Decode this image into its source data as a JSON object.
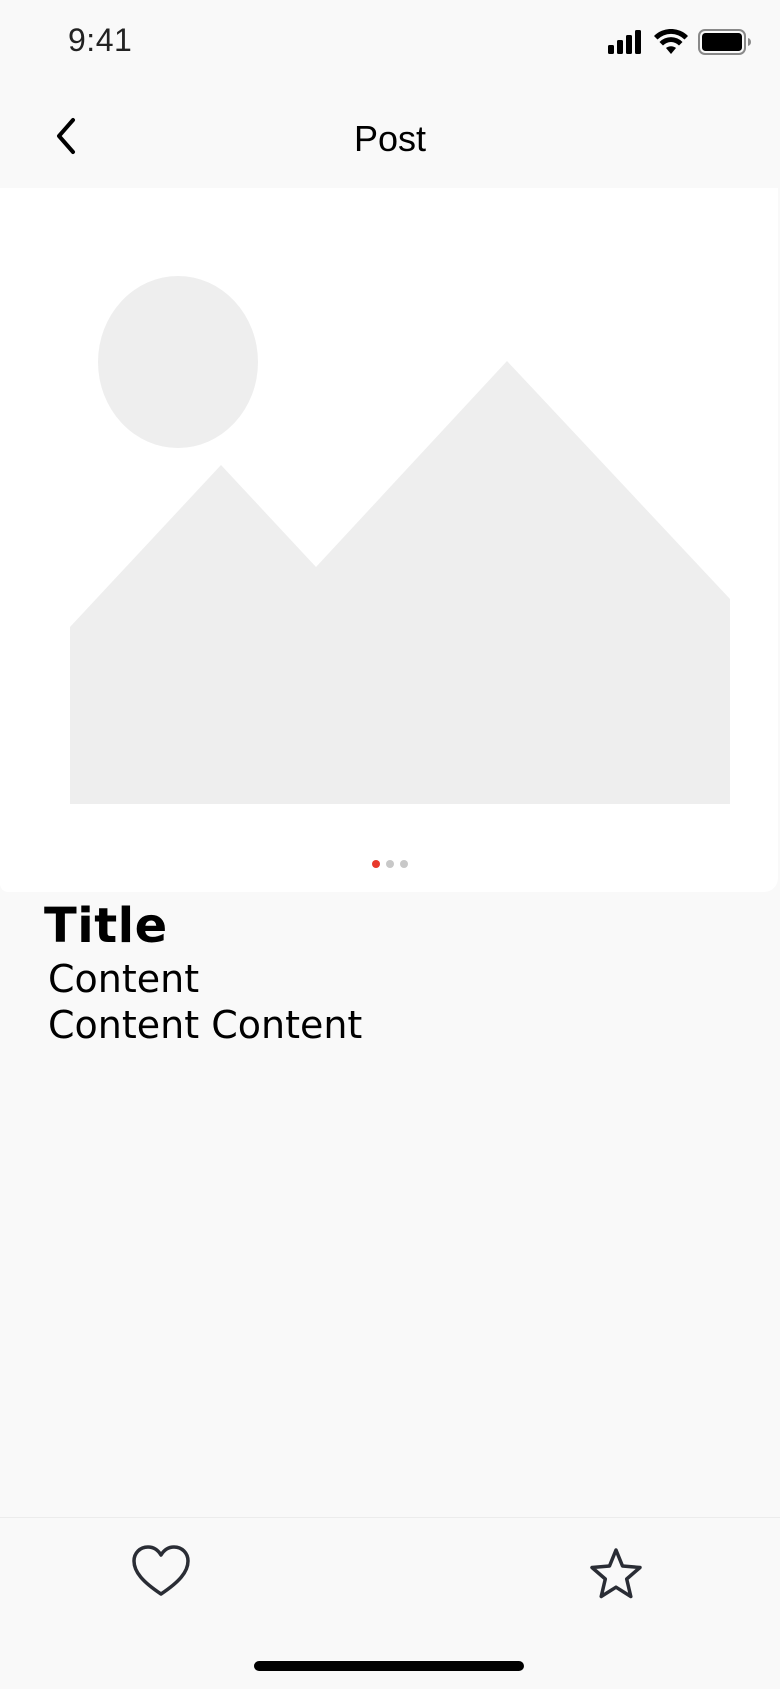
{
  "status_bar": {
    "time": "9:41",
    "icons": [
      "cellular-signal-icon",
      "wifi-icon",
      "battery-icon"
    ]
  },
  "nav": {
    "title": "Post",
    "back_icon": "chevron-left-icon"
  },
  "media": {
    "placeholder_icon": "image-placeholder-icon",
    "page_count": 3,
    "active_page": 1,
    "colors": {
      "placeholder": "#eeeeee",
      "active_dot": "#e8392c",
      "inactive_dot": "#c8c8c8"
    }
  },
  "post": {
    "title": "Title",
    "content_lines": [
      "Content",
      "Content Content"
    ]
  },
  "actions": {
    "like_icon": "heart-icon",
    "favorite_icon": "star-icon"
  }
}
